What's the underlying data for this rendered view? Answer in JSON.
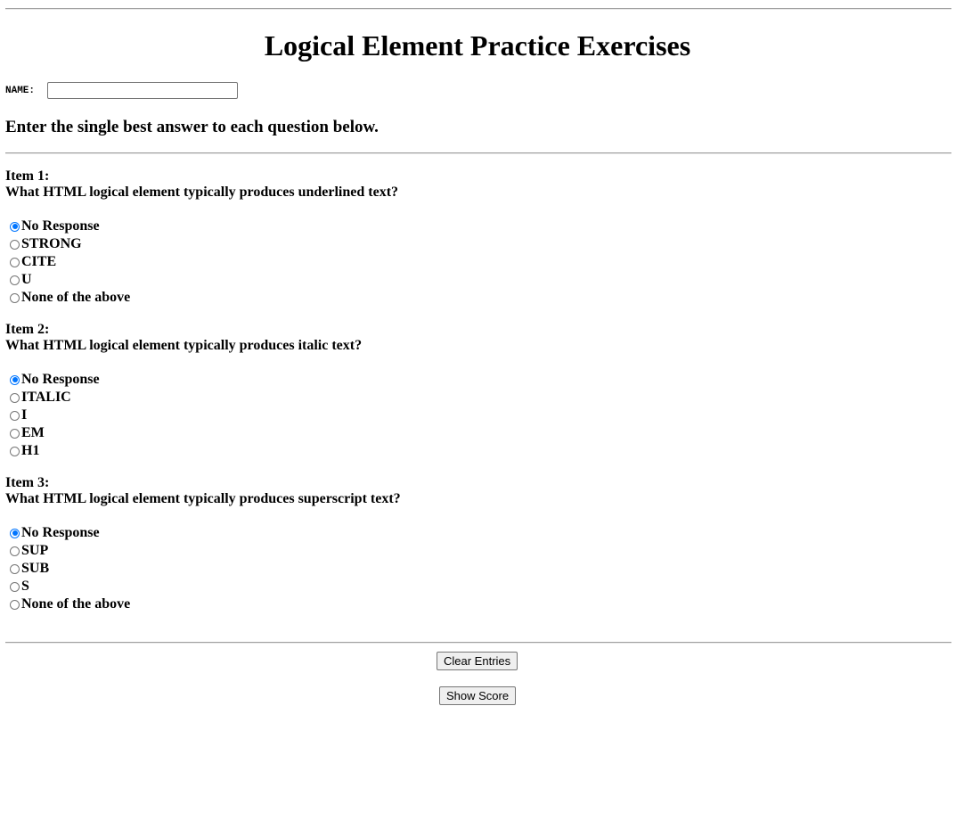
{
  "page": {
    "title": "Logical Element Practice Exercises",
    "name_label": "NAME:",
    "name_value": "",
    "instructions": "Enter the single best answer to each question below."
  },
  "items": [
    {
      "heading": "Item 1:",
      "question": "What HTML logical element typically produces underlined text?",
      "options": [
        "No Response",
        "STRONG",
        "CITE",
        "U",
        "None of the above"
      ],
      "selected": 0
    },
    {
      "heading": "Item 2:",
      "question": "What HTML logical element typically produces italic text?",
      "options": [
        "No Response",
        "ITALIC",
        "I",
        "EM",
        "H1"
      ],
      "selected": 0
    },
    {
      "heading": "Item 3:",
      "question": "What HTML logical element typically produces superscript text?",
      "options": [
        "No Response",
        "SUP",
        "SUB",
        "S",
        "None of the above"
      ],
      "selected": 0
    }
  ],
  "buttons": {
    "clear": "Clear Entries",
    "score": "Show Score"
  },
  "colors": {
    "accent": "#0075ff",
    "rule": "#a0a0a0"
  }
}
